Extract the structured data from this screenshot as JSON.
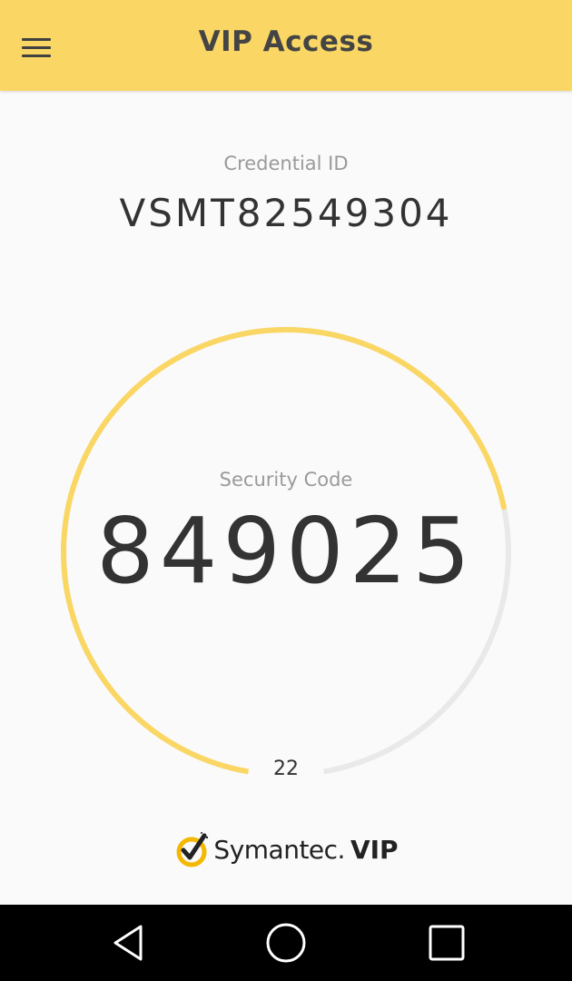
{
  "toolbar": {
    "title": "VIP Access",
    "menu_icon": "hamburger-menu-icon"
  },
  "credential": {
    "label": "Credential ID",
    "id": "VSMT82549304"
  },
  "security": {
    "label": "Security Code",
    "code": "849025",
    "seconds_remaining": "22",
    "progress_fraction": 0.73
  },
  "brand": {
    "name": "Symantec.",
    "product": "VIP"
  },
  "navigation": {
    "back_icon": "back-triangle-icon",
    "home_icon": "home-circle-icon",
    "recents_icon": "recents-square-icon"
  },
  "colors": {
    "accent": "#fad764",
    "toolbar_text": "#444444",
    "ring_track": "#e9e9e9",
    "ring_progress": "#fad764",
    "navbar": "#000000"
  }
}
